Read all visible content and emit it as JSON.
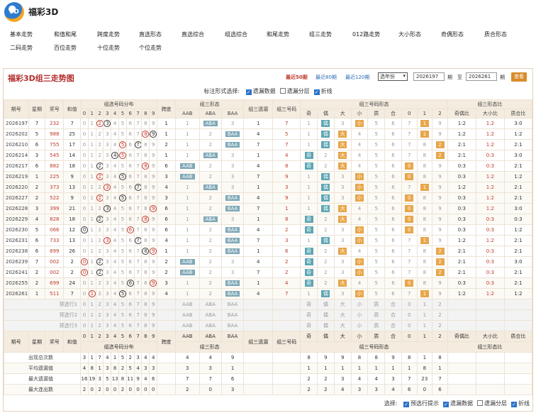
{
  "app": {
    "logo_text": "3D",
    "title": "福彩3D"
  },
  "nav": {
    "row1": [
      "基本走势",
      "和值和尾",
      "跨度走势",
      "直选形态",
      "直选综合",
      "组选综合",
      "和尾走势",
      "组三走势",
      "012路走势",
      "大小形态",
      "奇偶形态",
      "质合形态"
    ],
    "row2": [
      "二码走势",
      "百位走势",
      "十位走势",
      "个位走势"
    ]
  },
  "panel": {
    "title": "福彩3D组三走势图",
    "ranges": [
      "最近50期",
      "最近80期",
      "最近120期"
    ],
    "active_range": "最近50期",
    "select_value": "选年份",
    "from_value": "2026197",
    "from_label": "期",
    "to_label": "至",
    "to_value": "2026261",
    "to_suffix": "期",
    "query_label": "查看"
  },
  "marks": {
    "label": "标注形式选择:",
    "options": [
      {
        "label": "遗漏数据",
        "checked": true
      },
      {
        "label": "遗漏分层",
        "checked": false
      },
      {
        "label": "折线",
        "checked": true
      }
    ]
  },
  "headers": {
    "issue": "期号",
    "week": "星期",
    "prize": "奖号",
    "sum": "和值",
    "dist": "组选号码分布",
    "span": "跨度",
    "form": "组三形态",
    "miss": "组三遗漏",
    "code": "组三号码",
    "xt": "组三号码形态",
    "ratios": "组三形态比",
    "digits": [
      "0",
      "1",
      "2",
      "3",
      "4",
      "5",
      "6",
      "7",
      "8",
      "9"
    ],
    "forms": [
      "AAB",
      "ABA",
      "BAA"
    ],
    "xtcols": [
      "奇",
      "偶",
      "大",
      "小",
      "质",
      "合",
      "0",
      "1",
      "2"
    ],
    "ratiocols": [
      "奇偶比",
      "大小比",
      "质合比"
    ]
  },
  "rows": [
    {
      "issue": "2026197",
      "week": "7",
      "prize": "232",
      "sum": "7"
    },
    {
      "issue": "2026202",
      "week": "5",
      "prize": "988",
      "sum": "25"
    },
    {
      "issue": "2026210",
      "week": "6",
      "prize": "755",
      "sum": "17"
    },
    {
      "issue": "2026214",
      "week": "3",
      "prize": "545",
      "sum": "14"
    },
    {
      "issue": "2026217",
      "week": "6",
      "prize": "882",
      "sum": "18"
    },
    {
      "issue": "2026219",
      "week": "1",
      "prize": "225",
      "sum": "9"
    },
    {
      "issue": "2026220",
      "week": "2",
      "prize": "373",
      "sum": "13"
    },
    {
      "issue": "2026227",
      "week": "2",
      "prize": "522",
      "sum": "9"
    },
    {
      "issue": "2026228",
      "week": "3",
      "prize": "399",
      "sum": "21"
    },
    {
      "issue": "2026229",
      "week": "4",
      "prize": "828",
      "sum": "18"
    },
    {
      "issue": "2026230",
      "week": "5",
      "prize": "066",
      "sum": "12"
    },
    {
      "issue": "2026231",
      "week": "6",
      "prize": "733",
      "sum": "13"
    },
    {
      "issue": "2026238",
      "week": "6",
      "prize": "899",
      "sum": "26"
    },
    {
      "issue": "2026239",
      "week": "7",
      "prize": "002",
      "sum": "2"
    },
    {
      "issue": "2026241",
      "week": "2",
      "prize": "002",
      "sum": "2"
    },
    {
      "issue": "2026255",
      "week": "2",
      "prize": "699",
      "sum": "24"
    },
    {
      "issue": "2026261",
      "week": "1",
      "prize": "511",
      "sum": "7"
    }
  ],
  "preselect": [
    "预选行1",
    "预选行2",
    "预选行3"
  ],
  "stats": [
    {
      "label": "出现总次数",
      "dist": [
        "3",
        "1",
        "7",
        "4",
        "1",
        "5",
        "2",
        "3",
        "4",
        "4"
      ],
      "form": [
        "4",
        "4",
        "9"
      ],
      "xt": [
        "8",
        "9",
        "9",
        "8",
        "8",
        "9",
        "8",
        "1",
        "8"
      ]
    },
    {
      "label": "平均遗漏值",
      "dist": [
        "4",
        "8",
        "1",
        "3",
        "8",
        "2",
        "5",
        "4",
        "3",
        "3"
      ],
      "form": [
        "3",
        "3",
        "1"
      ],
      "xt": [
        "1",
        "1",
        "1",
        "1",
        "1",
        "1",
        "1",
        "8",
        "1"
      ]
    },
    {
      "label": "最大遗漏值",
      "dist": [
        "16",
        "19",
        "3",
        "5",
        "13",
        "8",
        "11",
        "9",
        "4",
        "6"
      ],
      "form": [
        "7",
        "7",
        "6"
      ],
      "xt": [
        "2",
        "2",
        "3",
        "4",
        "4",
        "3",
        "7",
        "23",
        "7"
      ]
    },
    {
      "label": "最大连出数",
      "dist": [
        "2",
        "0",
        "2",
        "0",
        "0",
        "2",
        "0",
        "0",
        "0",
        "0"
      ],
      "form": [
        "2",
        "0",
        "3"
      ],
      "xt": [
        "2",
        "2",
        "4",
        "3",
        "3",
        "4",
        "6",
        "0",
        "6"
      ]
    }
  ],
  "footer": {
    "label": "选择:",
    "options": [
      {
        "label": "预选行提示",
        "checked": true
      },
      {
        "label": "遗漏数据",
        "checked": true
      },
      {
        "label": "遗漏分层",
        "checked": false
      },
      {
        "label": "折线",
        "checked": true
      }
    ]
  }
}
